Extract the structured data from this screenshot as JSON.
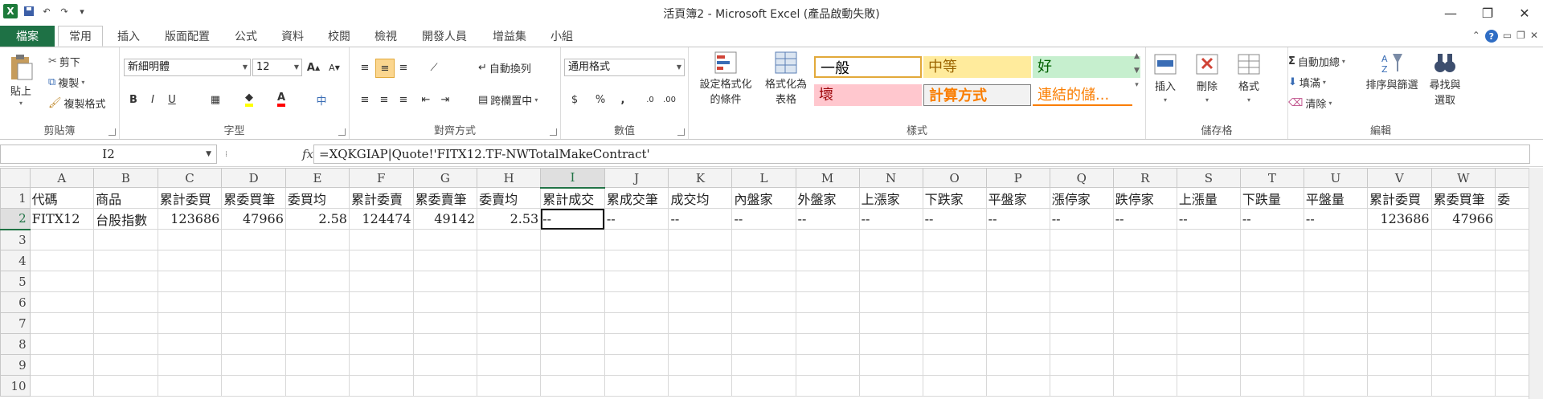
{
  "window": {
    "title": "活頁簿2 - Microsoft Excel (產品啟動失敗)",
    "controls": [
      "minimize",
      "restore",
      "close"
    ]
  },
  "quick_access": {
    "logo": "X",
    "undo_label": "↶",
    "redo_label": "↷"
  },
  "tabs": [
    {
      "label": "檔案"
    },
    {
      "label": "常用"
    },
    {
      "label": "插入"
    },
    {
      "label": "版面配置"
    },
    {
      "label": "公式"
    },
    {
      "label": "資料"
    },
    {
      "label": "校閱"
    },
    {
      "label": "檢視"
    },
    {
      "label": "開發人員"
    },
    {
      "label": "增益集"
    },
    {
      "label": "小組"
    }
  ],
  "ribbon": {
    "clipboard": {
      "group": "剪貼簿",
      "paste": "貼上",
      "cut": "剪下",
      "copy": "複製",
      "painter": "複製格式"
    },
    "font": {
      "group": "字型",
      "name": "新細明體",
      "size": "12",
      "bold": "B",
      "italic": "I",
      "underline": "U",
      "grow": "A",
      "shrink": "A"
    },
    "alignment": {
      "group": "對齊方式",
      "wrap": "自動換列",
      "merge": "跨欄置中"
    },
    "number": {
      "group": "數值",
      "format": "通用格式",
      "currency": "$",
      "percent": "%",
      "comma": ","
    },
    "styles": {
      "group": "樣式",
      "conditional": "設定格式化的條件",
      "table": "格式化為表格",
      "cells": [
        {
          "label": "一般",
          "bg": "#ffffff",
          "fg": "#000000"
        },
        {
          "label": "中等",
          "bg": "#ffeb9c",
          "fg": "#9c6500"
        },
        {
          "label": "好",
          "bg": "#c6efce",
          "fg": "#006100"
        },
        {
          "label": "壞",
          "bg": "#ffc7ce",
          "fg": "#9c0006"
        },
        {
          "label": "計算方式",
          "bg": "#f2f2f2",
          "fg": "#fa7d00"
        },
        {
          "label": "連結的儲...",
          "bg": "#ffffff",
          "fg": "#fa7d00"
        }
      ]
    },
    "cells_group": {
      "group": "儲存格",
      "insert": "插入",
      "delete": "刪除",
      "format": "格式"
    },
    "editing": {
      "group": "編輯",
      "autosum": "自動加總",
      "fill": "填滿",
      "clear": "清除",
      "sort": "排序與篩選",
      "find": "尋找與選取"
    }
  },
  "formula_bar": {
    "name_box": "I2",
    "fx": "fx",
    "formula": "=XQKGIAP|Quote!'FITX12.TF-NWTotalMakeContract'"
  },
  "sheet": {
    "columns": [
      "A",
      "B",
      "C",
      "D",
      "E",
      "F",
      "G",
      "H",
      "I",
      "J",
      "K",
      "L",
      "M",
      "N",
      "O",
      "P",
      "Q",
      "R",
      "S",
      "T",
      "U",
      "V",
      "W",
      ""
    ],
    "selected_column": "I",
    "rows": [
      [
        "1",
        "代碼",
        "商品",
        "累計委買",
        "累委買筆",
        "委買均",
        "累計委賣",
        "累委賣筆",
        "委賣均",
        "累計成交",
        "累成交筆",
        "成交均",
        "內盤家",
        "外盤家",
        "上漲家",
        "下跌家",
        "平盤家",
        "漲停家",
        "跌停家",
        "上漲量",
        "下跌量",
        "平盤量",
        "累計委買",
        "累委買筆",
        "委"
      ],
      [
        "2",
        "FITX12",
        "台股指數",
        "123686",
        "47966",
        "2.58",
        "124474",
        "49142",
        "2.53",
        "--",
        "--",
        "--",
        "--",
        "--",
        "--",
        "--",
        "--",
        "--",
        "--",
        "--",
        "--",
        "--",
        "123686",
        "47966",
        ""
      ],
      [
        "3"
      ],
      [
        "4"
      ],
      [
        "5"
      ],
      [
        "6"
      ],
      [
        "7"
      ],
      [
        "8"
      ],
      [
        "9"
      ],
      [
        "10"
      ]
    ]
  }
}
